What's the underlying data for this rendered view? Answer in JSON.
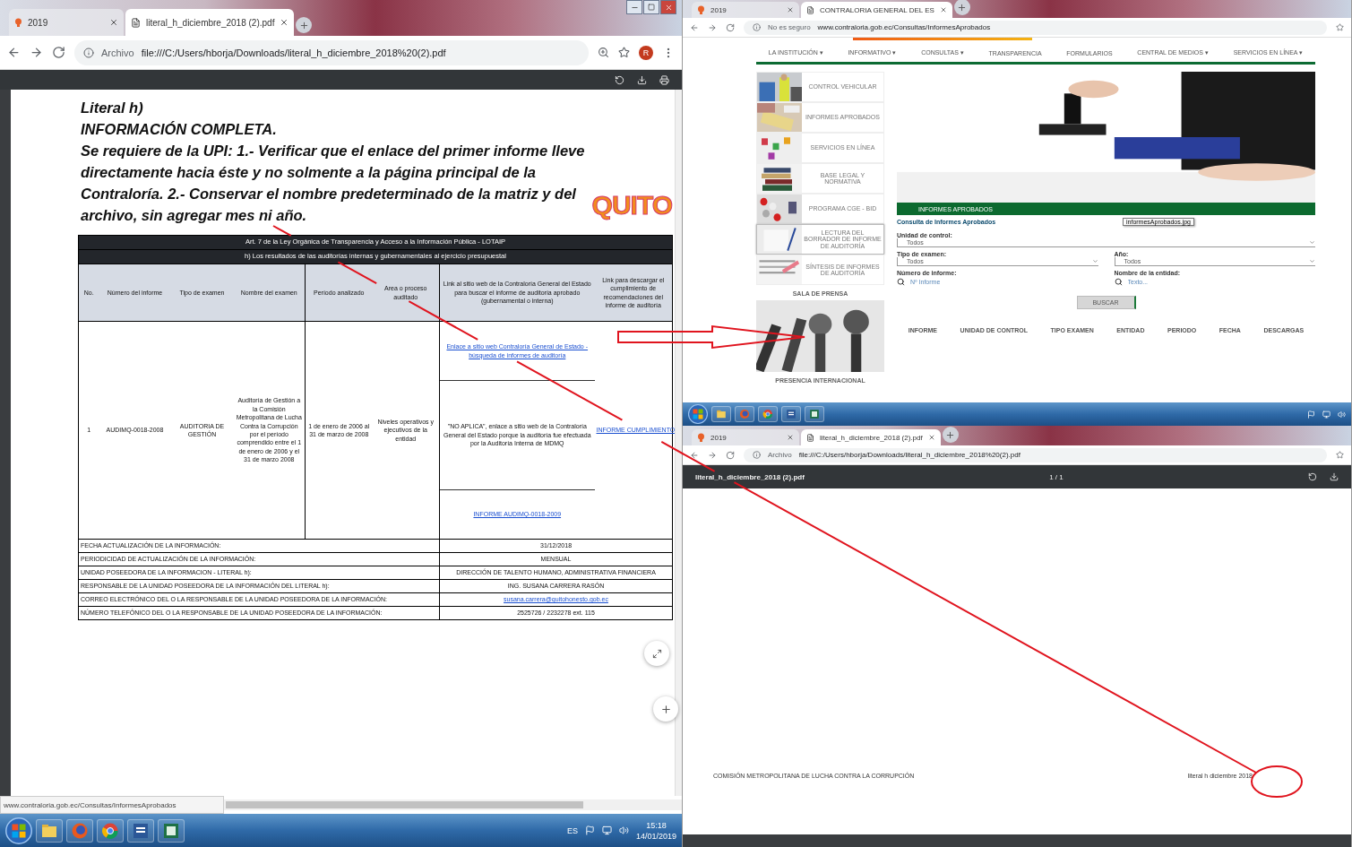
{
  "left_window": {
    "tabs": [
      {
        "label": "2019",
        "selected": false
      },
      {
        "label": "literal_h_diciembre_2018 (2).pdf",
        "selected": true
      }
    ],
    "address": {
      "scheme_label": "Archivo",
      "url": "file:///C:/Users/hborja/Downloads/literal_h_diciembre_2018%20(2).pdf"
    },
    "avatar": "R",
    "document": {
      "heading": "Literal h)",
      "subheading": "INFORMACIÓN COMPLETA.",
      "note": "Se requiere de la UPI: 1.- Verificar que el enlace del primer informe lleve directamente hacia éste y no solmente a la página principal de la Contraloría. 2.- Conservar el nombre predeterminado de la matriz y del archivo, sin agregar mes ni año.",
      "logo": "QUITO",
      "table": {
        "title": "Art. 7 de la Ley Orgánica de Transparencia y Acceso a la Información Pública - LOTAIP",
        "subtitle": "h) Los resultados de las auditorías internas y gubernamentales al ejercicio presupuestal",
        "columns": [
          "No.",
          "Número del informe",
          "Tipo de examen",
          "Nombre del examen",
          "Período analizado",
          "Area o proceso auditado",
          "Link al sitio web de la Contraloría General del Estado para buscar el informe de auditoría aprobado (gubernamental o interna)",
          "Link para descargar el cumplimiento de recomendaciones del informe de auditoría"
        ],
        "rows": [
          {
            "cells": [
              "1",
              "AUDIMQ-0018-2008",
              "AUDITORIA DE GESTIÓN",
              "Auditoría de Gestión a la Comisión Metropolitana de Lucha Contra la Corrupción por el período comprendido entre el 1 de enero de 2006 y el 31 de marzo 2008",
              "1 de enero de 2006 al 31 de marzo de 2008",
              "Niveles operativos y ejecutivos de la entidad"
            ],
            "search_links": [
              {
                "kind": "link",
                "text": "Enlace a sitio web Contraloría General de Estado - búsqueda de informes de auditoría"
              },
              {
                "kind": "text",
                "text": "\"NO APLICA\", enlace a sitio web de la Contraloría General del Estado porque la auditoría fue efectuada por la Auditoría Interna de MDMQ"
              },
              {
                "kind": "link",
                "text": "INFORME AUDIMQ-0018-2009"
              }
            ],
            "download_link": "INFORME CUMPLIMIENTO"
          }
        ],
        "footer": [
          {
            "label": "FECHA ACTUALIZACIÓN DE LA INFORMACIÓN:",
            "value": "31/12/2018",
            "kind": "text"
          },
          {
            "label": "PERIODICIDAD DE ACTUALIZACIÓN DE LA INFORMACIÓN:",
            "value": "MENSUAL",
            "kind": "text"
          },
          {
            "label": "UNIDAD POSEEDORA DE LA INFORMACION - LITERAL h):",
            "value": "DIRECCIÓN DE TALENTO HUMANO, ADMINISTRATIVA FINANCIERA",
            "kind": "text"
          },
          {
            "label": "RESPONSABLE DE LA UNIDAD POSEEDORA DE LA INFORMACIÓN DEL LITERAL h):",
            "value": "ING. SUSANA CARRERA RASÓN",
            "kind": "text"
          },
          {
            "label": "CORREO ELECTRÓNICO DEL O LA RESPONSABLE DE LA UNIDAD POSEEDORA DE LA INFORMACIÓN:",
            "value": "susana.carrera@quitohonesto.gob.ec",
            "kind": "link"
          },
          {
            "label": "NÚMERO TELEFÓNICO DEL O LA RESPONSABLE DE LA UNIDAD POSEEDORA DE LA INFORMACIÓN:",
            "value": "2525726 / 2232278 ext. 115",
            "kind": "text"
          }
        ]
      }
    },
    "status_link": "www.contraloria.gob.ec/Consultas/InformesAprobados",
    "taskbar": {
      "language": "ES",
      "time": "15:18",
      "date": "14/01/2019"
    }
  },
  "right_top_window": {
    "tabs": [
      {
        "label": "2019",
        "selected": false
      },
      {
        "label": "CONTRALORIA GENERAL DEL ES",
        "selected": true
      }
    ],
    "address": {
      "scheme_label": "No es seguro",
      "url": "www.contraloria.gob.ec/Consultas/InformesAprobados"
    },
    "nav": [
      "LA INSTITUCIÓN ▾",
      "INFORMATIVO ▾",
      "CONSULTAS ▾",
      "TRANSPARENCIA",
      "FORMULARIOS",
      "CENTRAL DE MEDIOS ▾",
      "SERVICIOS EN LÍNEA ▾"
    ],
    "sidebar": {
      "items": [
        {
          "label": "CONTROL VEHICULAR",
          "selected": false
        },
        {
          "label": "INFORMES APROBADOS",
          "selected": false
        },
        {
          "label": "SERVICIOS EN LÍNEA",
          "selected": false
        },
        {
          "label": "BASE LEGAL Y NORMATIVA",
          "selected": false
        },
        {
          "label": "PROGRAMA CGE - BID",
          "selected": false
        },
        {
          "label": "LECTURA DEL BORRADOR DE INFORME DE AUDITORÍA",
          "selected": true
        },
        {
          "label": "SÍNTESIS DE INFORMES DE AUDITORÍA",
          "selected": false
        }
      ],
      "press_title": "SALA DE PRENSA",
      "international_title": "PRESENCIA INTERNACIONAL"
    },
    "banner_title": "INFORMES APROBADOS",
    "form": {
      "title": "Consulta de Informes Aprobados",
      "tooltip": "informesAprobados.jpg",
      "unit": {
        "label": "Unidad de control:",
        "value": "Todos"
      },
      "exam_type": {
        "label": "Tipo de examen:",
        "value": "Todos"
      },
      "year": {
        "label": "Año:",
        "value": "Todos"
      },
      "report_number": {
        "label": "Número de informe:",
        "placeholder": "Nº Informe"
      },
      "entity": {
        "label": "Nombre de la entidad:",
        "placeholder": "Texto..."
      },
      "button": "BUSCAR"
    },
    "results_columns": [
      "INFORME",
      "UNIDAD DE CONTROL",
      "TIPO EXAMEN",
      "ENTIDAD",
      "PERIODO",
      "FECHA",
      "DESCARGAS"
    ]
  },
  "right_bottom_window": {
    "tabs": [
      {
        "label": "2019",
        "selected": false
      },
      {
        "label": "literal_h_diciembre_2018 (2).pdf",
        "selected": true
      }
    ],
    "address": {
      "scheme_label": "Archivo",
      "url": "file:///C:/Users/hborja/Downloads/literal_h_diciembre_2018%20(2).pdf"
    },
    "pdf_title": "literal_h_diciembre_2018 (2).pdf",
    "page_count": "1 / 1",
    "footer_left": "COMISIÓN METROPOLITANA DE LUCHA CONTRA LA CORRUPCIÓN",
    "footer_right": "literal h diciembre 2018"
  }
}
